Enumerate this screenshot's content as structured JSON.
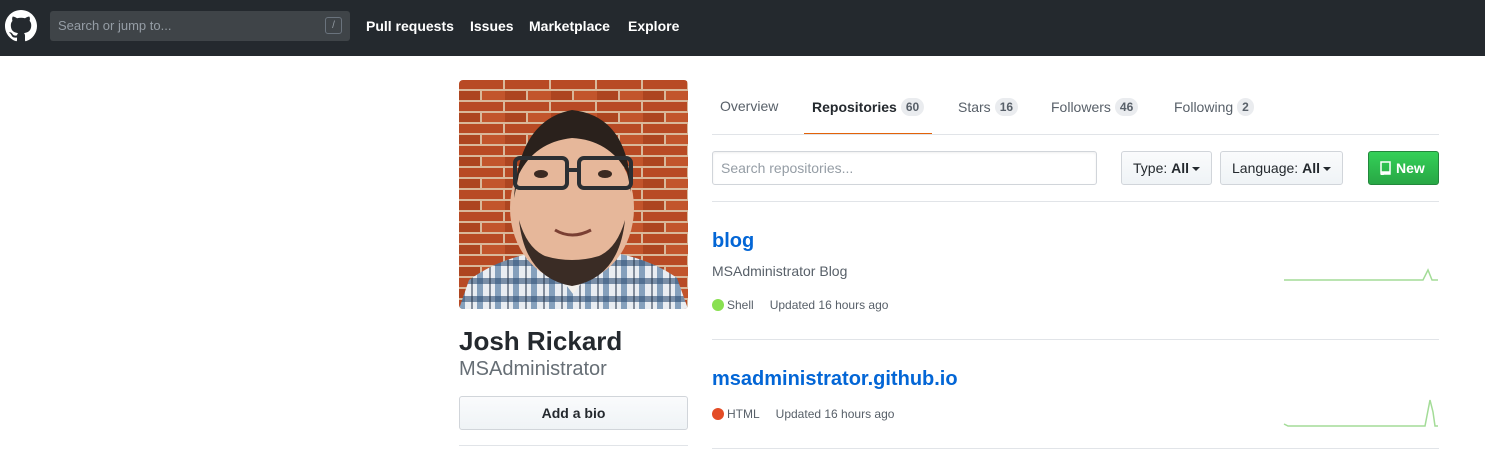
{
  "header": {
    "search_placeholder": "Search or jump to...",
    "search_shortcut": "/",
    "nav": [
      "Pull requests",
      "Issues",
      "Marketplace",
      "Explore"
    ]
  },
  "profile": {
    "name": "Josh Rickard",
    "login": "MSAdministrator",
    "add_bio_label": "Add a bio"
  },
  "tabs": [
    {
      "label": "Overview",
      "count": ""
    },
    {
      "label": "Repositories",
      "count": "60"
    },
    {
      "label": "Stars",
      "count": "16"
    },
    {
      "label": "Followers",
      "count": "46"
    },
    {
      "label": "Following",
      "count": "2"
    }
  ],
  "filters": {
    "search_placeholder": "Search repositories...",
    "type_label": "Type:",
    "type_value": "All",
    "language_label": "Language:",
    "language_value": "All",
    "new_label": "New"
  },
  "repos": [
    {
      "name": "blog",
      "description": "MSAdministrator Blog",
      "language": "Shell",
      "language_color": "#89e051",
      "updated": "Updated 16 hours ago"
    },
    {
      "name": "msadministrator.github.io",
      "description": "",
      "language": "HTML",
      "language_color": "#e34c26",
      "updated": "Updated 16 hours ago"
    }
  ],
  "colors": {
    "header_bg": "#24292e",
    "link": "#0366d6",
    "selected_tab_underline": "#e36209",
    "new_button": "#28a745"
  }
}
